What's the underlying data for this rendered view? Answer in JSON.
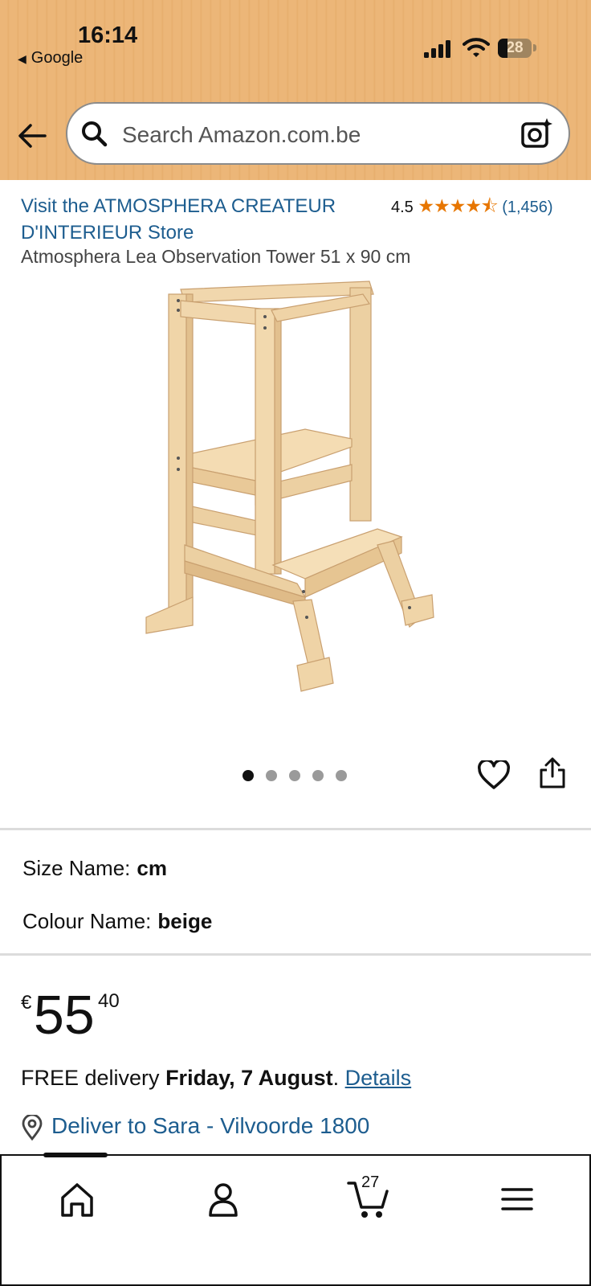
{
  "status_bar": {
    "time": "16:14",
    "back_app": "Google",
    "battery": "28"
  },
  "search": {
    "placeholder": "Search Amazon.com.be"
  },
  "store": {
    "link": "Visit the ATMOSPHERA CREATEUR D'INTERIEUR Store"
  },
  "rating": {
    "value": "4.5",
    "stars": "★★★★⯪",
    "count": "(1,456)"
  },
  "product": {
    "title": "Atmosphera Lea Observation Tower 51 x 90 cm"
  },
  "gallery": {
    "image_count": 5,
    "active_index": 0
  },
  "options": {
    "size_label": "Size Name:",
    "size_value": "cm",
    "colour_label": "Colour Name:",
    "colour_value": "beige"
  },
  "price": {
    "currency": "€",
    "whole": "55",
    "fraction": "40"
  },
  "delivery": {
    "prefix": "FREE delivery ",
    "date": "Friday, 7 August",
    "suffix": ". ",
    "details_link": "Details",
    "deliver_to": "Deliver to Sara - Vilvoorde 1800"
  },
  "bottom_nav": {
    "cart_count": "27"
  },
  "colors": {
    "header": "#ecb678",
    "link": "#1d5d8f",
    "star": "#e77600"
  }
}
